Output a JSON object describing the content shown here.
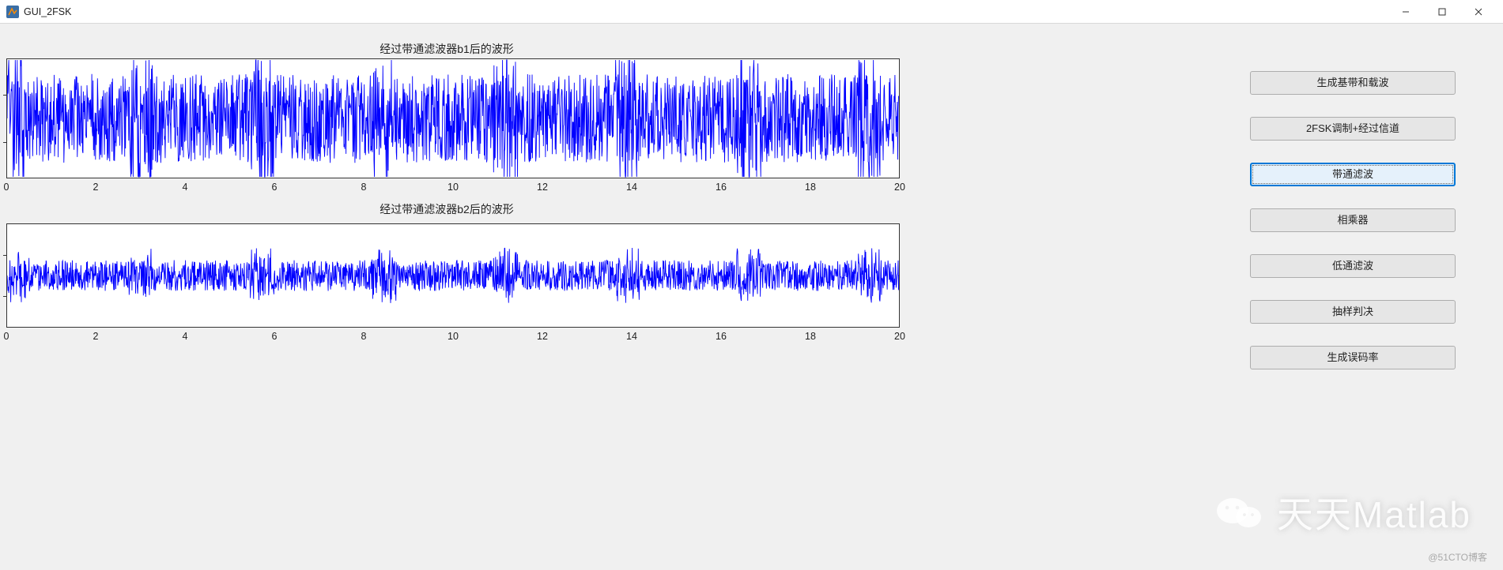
{
  "window": {
    "title": "GUI_2FSK"
  },
  "plots": {
    "title1": "经过带通滤波器b1后的波形",
    "title2": "经过带通滤波器b2后的波形",
    "xticks": [
      "0",
      "2",
      "4",
      "6",
      "8",
      "10",
      "12",
      "14",
      "16",
      "18",
      "20"
    ]
  },
  "buttons": {
    "b1": "生成基带和载波",
    "b2": "2FSK调制+经过信道",
    "b3": "带通滤波",
    "b4": "相乘器",
    "b5": "低通滤波",
    "b6": "抽样判决",
    "b7": "生成误码率"
  },
  "watermark": {
    "text": "天天Matlab"
  },
  "blog_tag": "@51CTO博客",
  "chart_data": [
    {
      "type": "line",
      "title": "经过带通滤波器b1后的波形",
      "xlabel": "",
      "ylabel": "",
      "xlim": [
        0,
        20
      ],
      "ylim": [
        -2,
        2
      ],
      "note": "Dense noisy bandpass-filtered FSK signal; amplitude varies roughly ±1.5 with bursts up to ±2. X axis ticks at 0..20 step 2.",
      "xticks": [
        0,
        2,
        4,
        6,
        8,
        10,
        12,
        14,
        16,
        18,
        20
      ]
    },
    {
      "type": "line",
      "title": "经过带通滤波器b2后的波形",
      "xlabel": "",
      "ylabel": "",
      "xlim": [
        0,
        20
      ],
      "ylim": [
        -1,
        1
      ],
      "note": "Dense noisy bandpass-filtered signal tighter amplitude roughly ±0.6 with spikes to ±1. X axis ticks at 0..20 step 2.",
      "xticks": [
        0,
        2,
        4,
        6,
        8,
        10,
        12,
        14,
        16,
        18,
        20
      ]
    }
  ]
}
